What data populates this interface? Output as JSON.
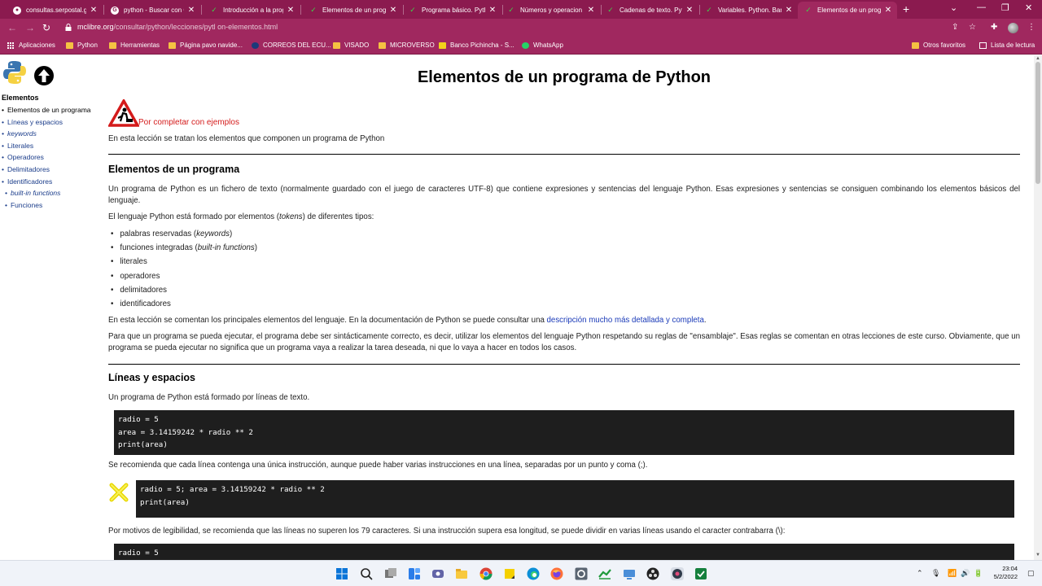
{
  "browser": {
    "tabs": [
      {
        "title": "consultas.serpostal.gc",
        "icon": "globe-icon"
      },
      {
        "title": "python - Buscar con G",
        "icon": "google-icon"
      },
      {
        "title": "Introducción a la prog",
        "icon": "check-icon"
      },
      {
        "title": "Elementos de un prog",
        "icon": "check-icon"
      },
      {
        "title": "Programa básico. Pyth",
        "icon": "check-icon"
      },
      {
        "title": "Números y operacion",
        "icon": "check-icon"
      },
      {
        "title": "Cadenas de texto. Pyt",
        "icon": "check-icon"
      },
      {
        "title": "Variables. Python. Bar",
        "icon": "check-icon"
      },
      {
        "title": "Elementos de un prog",
        "icon": "check-icon",
        "active": true
      }
    ],
    "new_tab": "+",
    "url_host": "mclibre.org",
    "url_path": "/consultar/python/lecciones/pytl on-elementos.html",
    "accent_color": "#a0285f",
    "tabstrip_color": "#8b1a4f"
  },
  "bookmarks": {
    "items": [
      {
        "label": "Aplicaciones",
        "icon": "apps-icon"
      },
      {
        "label": "Python",
        "icon": "folder-icon"
      },
      {
        "label": "Herramientas",
        "icon": "folder-icon"
      },
      {
        "label": "Página pavo navide...",
        "icon": "folder-icon"
      },
      {
        "label": "CORREOS DEL ECU...",
        "icon": "correos-icon"
      },
      {
        "label": "VISADO",
        "icon": "folder-icon"
      },
      {
        "label": "MICROVERSO",
        "icon": "folder-icon"
      },
      {
        "label": "Banco Pichincha - S...",
        "icon": "bank-icon"
      },
      {
        "label": "WhatsApp",
        "icon": "whatsapp-icon"
      }
    ],
    "others": "Otros favoritos",
    "reading_list": "Lista de lectura"
  },
  "sidebar": {
    "title": "Elementos",
    "items": [
      {
        "label": "Elementos de un programa",
        "style": "normal"
      },
      {
        "label": "Líneas y espacios",
        "style": "normal"
      },
      {
        "label": "keywords",
        "style": "italic"
      },
      {
        "label": "Literales",
        "style": "normal"
      },
      {
        "label": "Operadores",
        "style": "normal"
      },
      {
        "label": "Delimitadores",
        "style": "normal"
      },
      {
        "label": "Identificadores",
        "style": "normal"
      },
      {
        "label": "built-in functions",
        "style": "italic-sub"
      },
      {
        "label": "Funciones",
        "style": "sub"
      }
    ]
  },
  "main": {
    "title": "Elementos de un programa de Python",
    "warning": "Por completar con ejemplos",
    "intro": "En esta lección se tratan los elementos que componen un programa de Python",
    "section1": {
      "heading": "Elementos de un programa",
      "p1": "Un programa de Python es un fichero de texto (normalmente guardado con el juego de caracteres UTF-8) que contiene expresiones y sentencias del lenguaje Python. Esas expresiones y sentencias se consiguen combinando los elementos básicos del lenguaje.",
      "p2_before": "El lenguaje Python está formado por elementos (",
      "p2_em": "tokens",
      "p2_after": ") de diferentes tipos:",
      "bullets": {
        "b1_before": "palabras reservadas (",
        "b1_em": "keywords",
        "b1_after": ")",
        "b2_before": "funciones integradas (",
        "b2_em": "built-in functions",
        "b2_after": ")",
        "b3": "literales",
        "b4": "operadores",
        "b5": "delimitadores",
        "b6": "identificadores"
      },
      "p3_before": "En esta lección se comentan los principales elementos del lenguaje. En la documentación de Python se puede consultar una ",
      "p3_link": "descripción mucho más detallada y completa",
      "p3_after": ".",
      "p4": "Para que un programa se pueda ejecutar, el programa debe ser sintácticamente correcto, es decir, utilizar los elementos del lenguaje Python respetando su reglas de \"ensamblaje\". Esas reglas se comentan en otras lecciones de este curso. Obviamente, que un programa se pueda ejecutar no significa que un programa vaya a realizar la tarea deseada, ni que lo vaya a hacer en todos los casos."
    },
    "section2": {
      "heading": "Líneas y espacios",
      "p1": "Un programa de Python está formado por líneas de texto.",
      "code1": [
        "radio = 5",
        "area = 3.14159242 * radio ** 2",
        "print(area)"
      ],
      "p2": "Se recomienda que cada línea contenga una única instrucción, aunque puede haber varias instrucciones en una línea, separadas por un punto y coma (;).",
      "code2": [
        "radio = 5; area = 3.14159242 * radio ** 2",
        "print(area)"
      ],
      "p3": "Por motivos de legibilidad, se recomienda que las líneas no superen los 79 caracteres. Si una instrucción supera esa longitud, se puede dividir en varias líneas usando el caracter contrabarra (\\):",
      "code3": [
        "radio = 5"
      ]
    }
  },
  "taskbar": {
    "apps": [
      "windows-start-icon",
      "search-icon",
      "task-view-icon",
      "widgets-icon",
      "teams-icon",
      "file-explorer-icon",
      "chrome-icon",
      "sticky-notes-icon",
      "edge-icon",
      "firefox-icon",
      "settings-icon",
      "terminal-icon",
      "remote-icon",
      "obs-icon",
      "app-icon",
      "app-green-icon"
    ],
    "time": "23:04",
    "date": "5/2/2022"
  }
}
